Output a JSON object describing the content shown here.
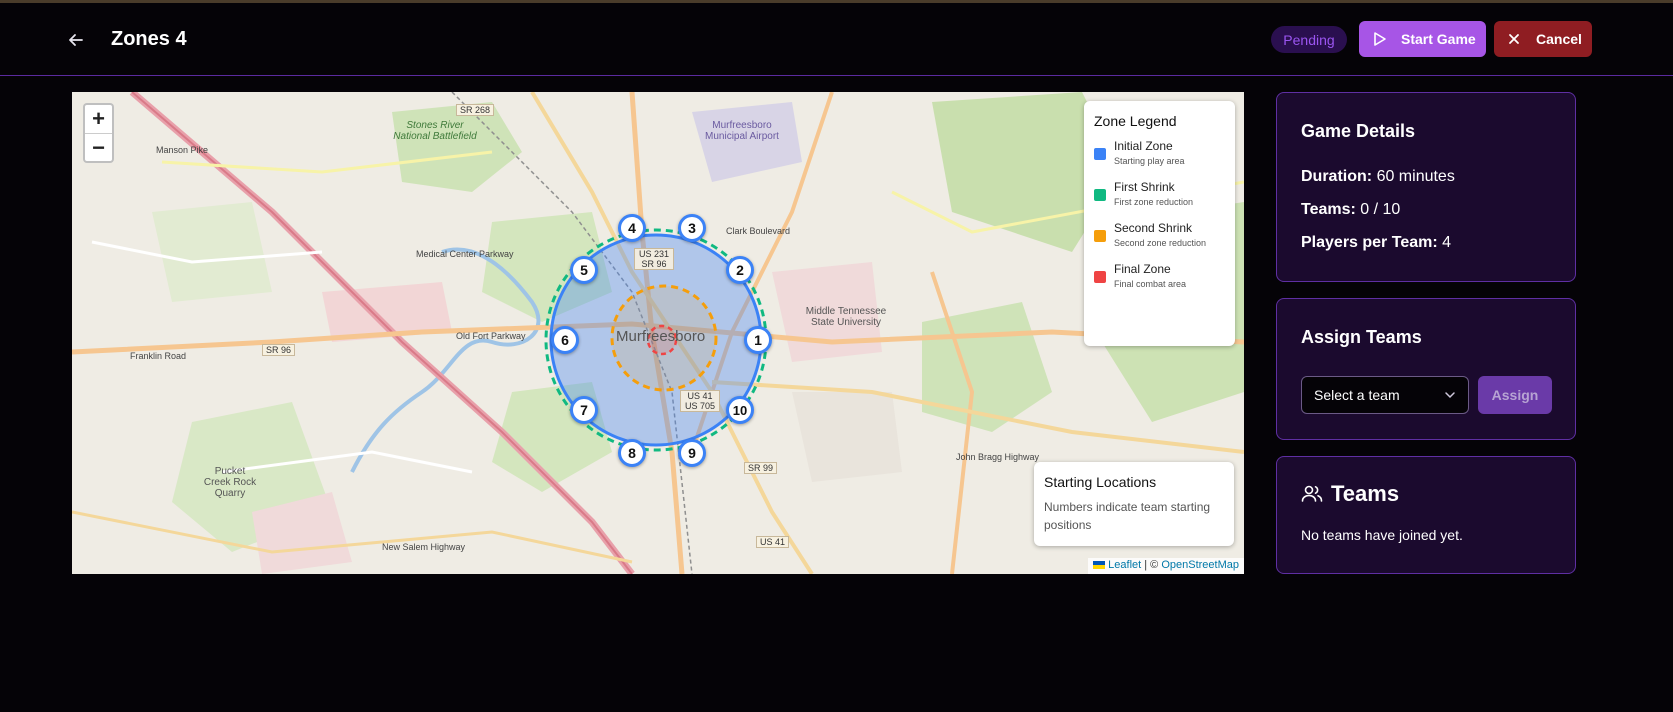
{
  "header": {
    "title": "Zones 4",
    "status": "Pending",
    "start_label": "Start Game",
    "cancel_label": "Cancel"
  },
  "map": {
    "zoom_in": "+",
    "zoom_out": "−",
    "city_label": "Murfreesboro",
    "place_labels": {
      "stones_river": "Stones River National Battlefield",
      "airport": "Murfreesboro Municipal Airport",
      "mtsu": "Middle Tennessee State University",
      "pucket": "Pucket Creek Rock Quarry",
      "franklin": "Franklin Road",
      "manson": "Manson Pike",
      "sr268": "SR 268",
      "sr96": "SR 96",
      "sr99": "SR 99",
      "us41": "US 41",
      "us231": "US 231 SR 96",
      "us41_705": "US 41 US 705",
      "old_fort": "Old Fort Parkway",
      "clark": "Clark Boulevard",
      "new_salem": "New Salem Highway",
      "medical_center": "Medical Center Parkway",
      "john_bragg": "John Bragg Highway"
    },
    "legend": {
      "title": "Zone Legend",
      "items": [
        {
          "name": "Initial Zone",
          "desc": "Starting play area",
          "color": "#3b82f6"
        },
        {
          "name": "First Shrink",
          "desc": "First zone reduction",
          "color": "#10b981"
        },
        {
          "name": "Second Shrink",
          "desc": "Second zone reduction",
          "color": "#f59e0b"
        },
        {
          "name": "Final Zone",
          "desc": "Final combat area",
          "color": "#ef4444"
        }
      ]
    },
    "starting_locations": {
      "title": "Starting Locations",
      "text": "Numbers indicate team starting positions"
    },
    "attribution": {
      "leaflet": "Leaflet",
      "separator": " | © ",
      "osm": "OpenStreetMap"
    },
    "markers": [
      "1",
      "2",
      "3",
      "4",
      "5",
      "6",
      "7",
      "8",
      "9",
      "10"
    ]
  },
  "game_details": {
    "title": "Game Details",
    "duration_label": "Duration:",
    "duration_value": "60 minutes",
    "teams_label": "Teams:",
    "teams_value": "0 / 10",
    "players_label": "Players per Team:",
    "players_value": "4"
  },
  "assign_teams": {
    "title": "Assign Teams",
    "select_value": "Select a team",
    "button_label": "Assign"
  },
  "teams": {
    "title": "Teams",
    "empty_text": "No teams have joined yet."
  }
}
